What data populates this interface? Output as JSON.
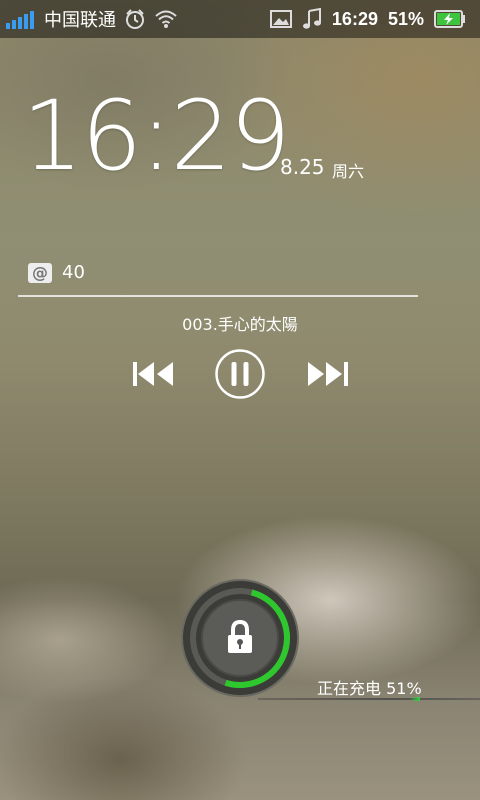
{
  "status_bar": {
    "carrier": "中国联通",
    "time": "16:29",
    "battery_percent": "51%",
    "icons": [
      "signal-icon",
      "alarm-icon",
      "wifi-icon",
      "image-icon",
      "music-note-icon",
      "battery-charging-icon"
    ],
    "accent_color": "#3a9cf0",
    "battery_color": "#3ec43e"
  },
  "clock": {
    "time": "16:29",
    "date": "8.25",
    "weekday": "周六"
  },
  "notifications": {
    "icon": "email-at-icon",
    "count": "40"
  },
  "music": {
    "track_title": "003.手心的太陽",
    "controls": [
      "previous-track-icon",
      "pause-icon",
      "next-track-icon"
    ]
  },
  "lock": {
    "icon": "padlock-icon",
    "charge_progress": 0.51,
    "ring_color": "#2ec82e"
  },
  "charging": {
    "label": "正在充电 51%"
  }
}
